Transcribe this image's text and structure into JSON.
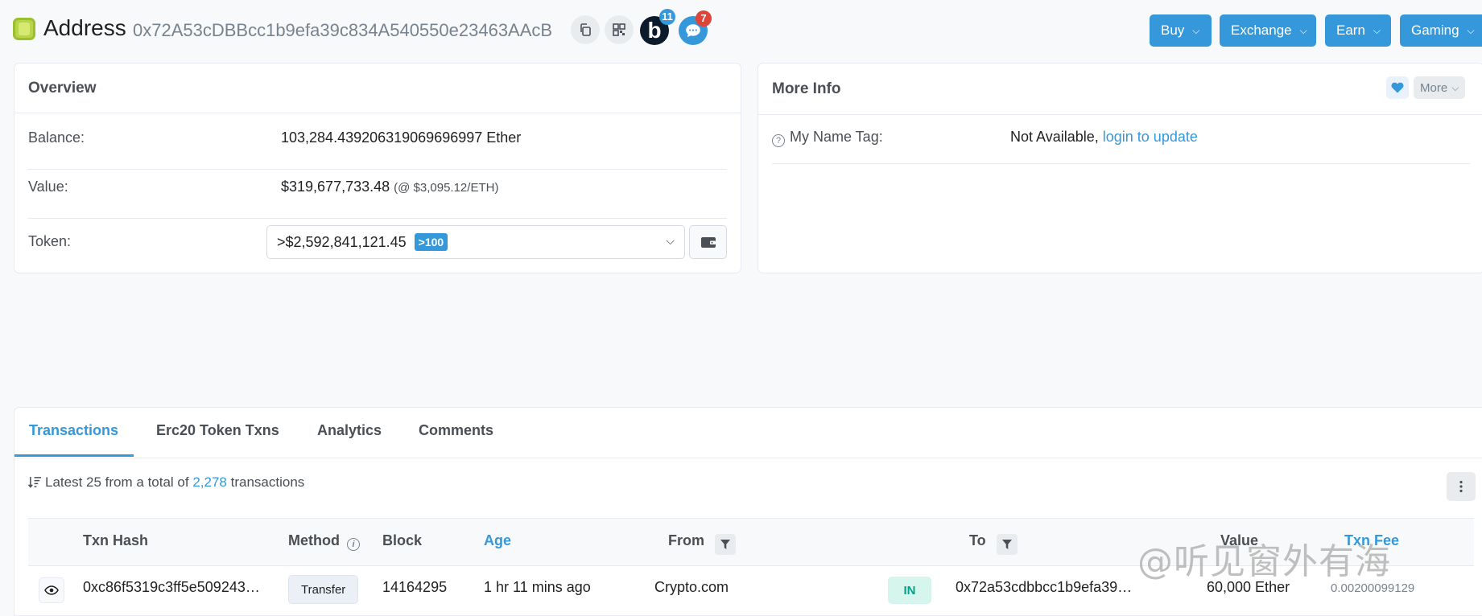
{
  "header": {
    "title": "Address",
    "address": "0x72A53cDBBcc1b9efa39c834A540550e23463AAcB",
    "badge_b_letter": "b",
    "badge_b_count": "11",
    "chat_count": "7",
    "menus": [
      {
        "label": "Buy"
      },
      {
        "label": "Exchange"
      },
      {
        "label": "Earn"
      },
      {
        "label": "Gaming"
      }
    ]
  },
  "overview": {
    "title": "Overview",
    "balance_label": "Balance:",
    "balance_value": "103,284.439206319069696997 Ether",
    "value_label": "Value:",
    "value_amount": "$319,677,733.48",
    "value_rate": "(@ $3,095.12/ETH)",
    "token_label": "Token:",
    "token_value": ">$2,592,841,121.45",
    "token_badge": ">100"
  },
  "more_info": {
    "title": "More Info",
    "more_label": "More",
    "name_tag_label": "My Name Tag:",
    "name_tag_value": "Not Available,",
    "name_tag_link": "login to update"
  },
  "transactions": {
    "tabs": [
      {
        "label": "Transactions",
        "active": true
      },
      {
        "label": "Erc20 Token Txns",
        "active": false
      },
      {
        "label": "Analytics",
        "active": false
      },
      {
        "label": "Comments",
        "active": false
      }
    ],
    "summary_prefix": "Latest 25 from a total of",
    "summary_count": "2,278",
    "summary_suffix": "transactions",
    "columns": {
      "txn_hash": "Txn Hash",
      "method": "Method",
      "block": "Block",
      "age": "Age",
      "from": "From",
      "to": "To",
      "value": "Value",
      "txn_fee": "Txn Fee"
    },
    "rows": [
      {
        "txn_hash": "0xc86f5319c3ff5e509243…",
        "method": "Transfer",
        "block": "14164295",
        "age": "1 hr 11 mins ago",
        "from": "Crypto.com",
        "direction": "IN",
        "to": "0x72a53cdbbcc1b9efa39…",
        "value": "60,000 Ether",
        "txn_fee": "0.00200099129"
      }
    ]
  },
  "watermark": "@听见窗外有海",
  "colors": {
    "accent": "#3498db",
    "in_badge_bg": "#d6f5ec",
    "in_badge_text": "#00a186",
    "alert_red": "#de4437",
    "page_bg": "#f8f9fa"
  }
}
